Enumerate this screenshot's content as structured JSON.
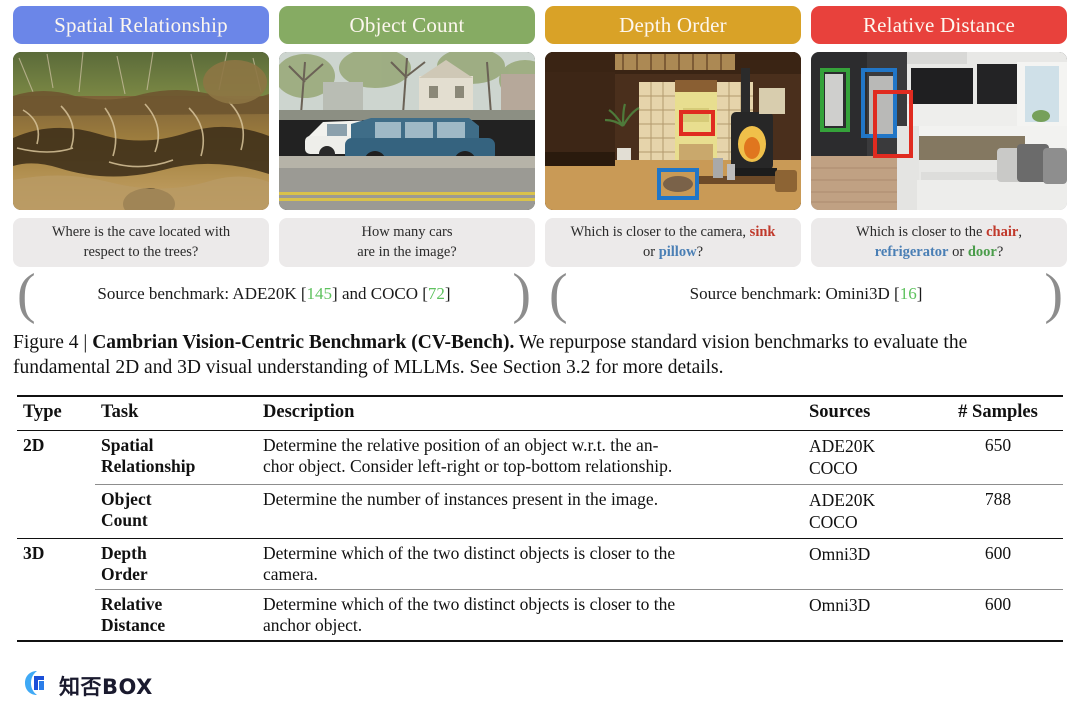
{
  "tabs": [
    {
      "label": "Spatial Relationship",
      "color": "#6b86e8"
    },
    {
      "label": "Object Count",
      "color": "#86ab63"
    },
    {
      "label": "Depth Order",
      "color": "#d9a227"
    },
    {
      "label": "Relative Distance",
      "color": "#e8413c"
    }
  ],
  "images": [
    {
      "name": "cave-roots-photo",
      "alt": "cross-section of soil with tree roots and a cave opening"
    },
    {
      "name": "street-cars-photo",
      "alt": "street scene with a white sedan and a blue station wagon parked"
    },
    {
      "name": "japanese-room-photo",
      "alt": "traditional room with wood stove, red box around sink and blue box around pillow"
    },
    {
      "name": "modern-kitchen-photo",
      "alt": "modern open kitchen with green box on door, blue box on refrigerator, red box on chair"
    }
  ],
  "questions": [
    {
      "parts": [
        {
          "text": "Where is the cave located with"
        },
        {
          "text": "respect to the trees?"
        }
      ]
    },
    {
      "parts": [
        {
          "text": "How many cars"
        },
        {
          "text": "are in the image?"
        }
      ]
    },
    {
      "line1_pre": "Which is closer to the camera, ",
      "kw1": "sink",
      "line2_pre": "or ",
      "kw2": "pillow",
      "line2_post": "?"
    },
    {
      "line1_pre": "Which is closer to the ",
      "kw1": "chair",
      "line1_post": ",",
      "kw2": "refrigerator",
      "line2_mid": " or ",
      "kw3": "door",
      "line2_post": "?"
    }
  ],
  "sources": [
    {
      "prefix": "Source benchmark: ADE20K [",
      "cite1": "145",
      "middle": "] and COCO [",
      "cite2": "72",
      "suffix": "]"
    },
    {
      "prefix": "Source benchmark: Omini3D [",
      "cite1": "16",
      "suffix": "]"
    }
  ],
  "caption": {
    "figure_label": "Figure 4 | ",
    "bold_title": "Cambrian Vision-Centric Benchmark (CV-Bench).",
    "body": " We repurpose standard vision benchmarks to evaluate the fundamental 2D and 3D visual understanding of MLLMs. See Section 3.2 for more details."
  },
  "table": {
    "headers": {
      "type": "Type",
      "task": "Task",
      "description": "Description",
      "sources": "Sources",
      "samples": "# Samples"
    },
    "rows": [
      {
        "type": "2D",
        "task_line1": "Spatial",
        "task_line2": "Relationship",
        "desc_line1": "Determine the relative position of an object w.r.t. the an-",
        "desc_line2": "chor object. Consider left-right or top-bottom relationship.",
        "src_line1": "ADE20K",
        "src_line2": "COCO",
        "samples": "650"
      },
      {
        "type": "",
        "task_line1": "Object",
        "task_line2": "Count",
        "desc_line1": "Determine the number of instances present in the image.",
        "desc_line2": "",
        "src_line1": "ADE20K",
        "src_line2": "COCO",
        "samples": "788"
      },
      {
        "type": "3D",
        "task_line1": "Depth",
        "task_line2": "Order",
        "desc_line1": "Determine which of the two distinct objects is closer to the",
        "desc_line2": "camera.",
        "src_line1": "Omni3D",
        "src_line2": "",
        "samples": "600"
      },
      {
        "type": "",
        "task_line1": "Relative",
        "task_line2": "Distance",
        "desc_line1": "Determine which of the two distinct objects is closer to the",
        "desc_line2": "anchor object.",
        "src_line1": "Omni3D",
        "src_line2": "",
        "samples": "600"
      }
    ]
  },
  "watermark": {
    "text": "知否BOX"
  }
}
